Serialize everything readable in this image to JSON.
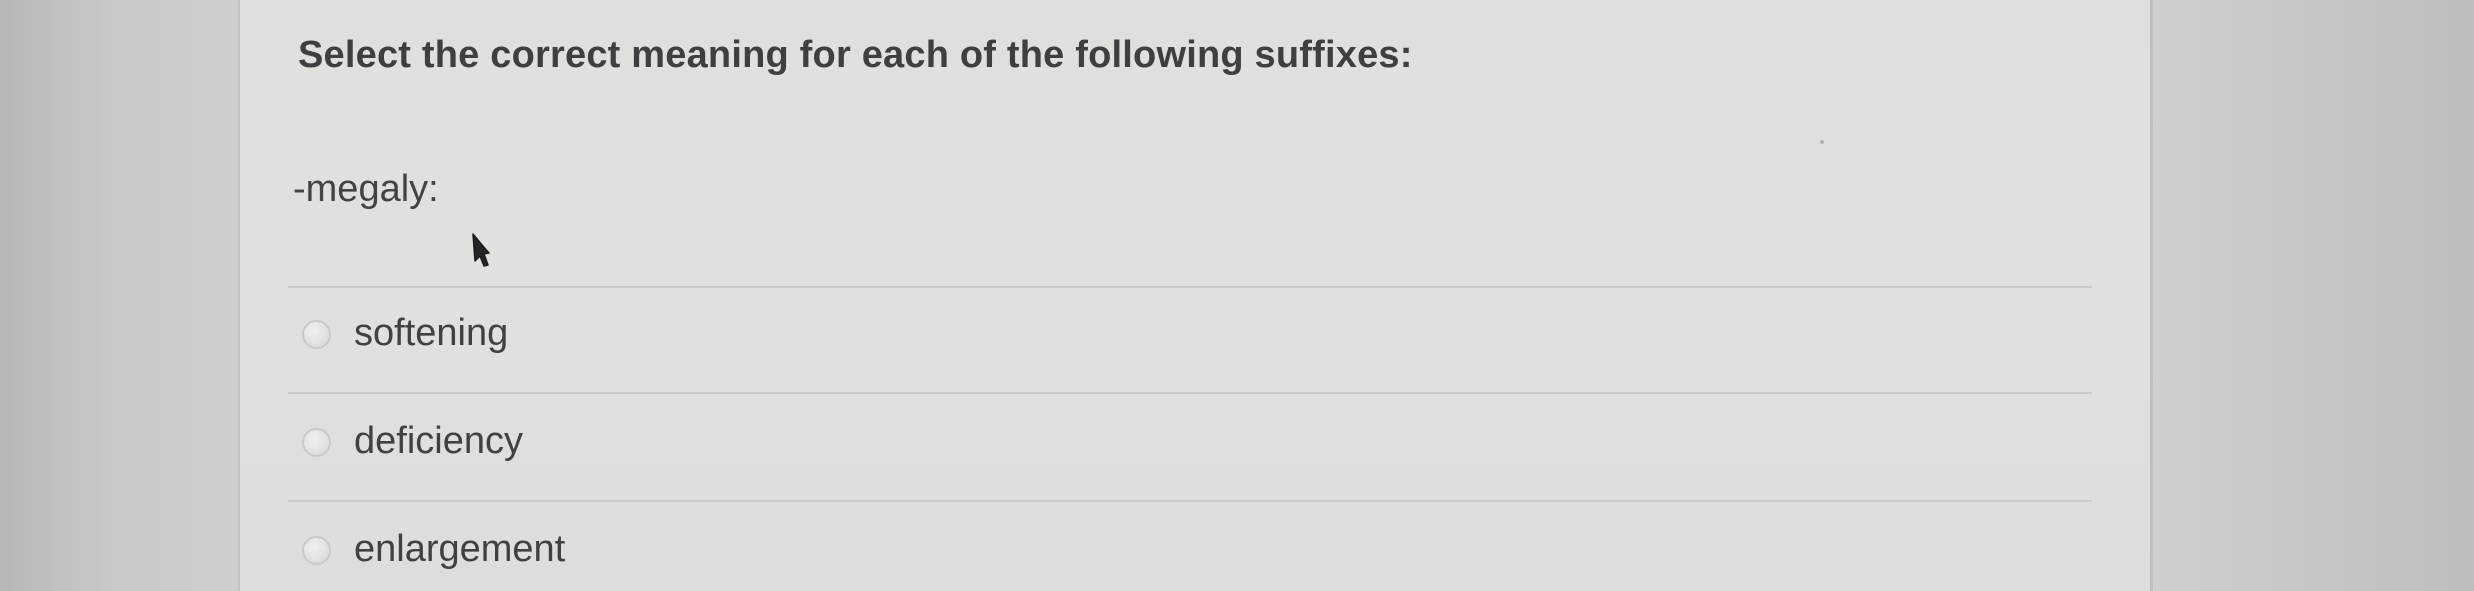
{
  "question": {
    "title": "Select the correct meaning for each of the following suffixes:",
    "term": "-megaly:"
  },
  "options": [
    {
      "label": "softening",
      "selected": false
    },
    {
      "label": "deficiency",
      "selected": false
    },
    {
      "label": "enlargement",
      "selected": false
    }
  ],
  "icons": {
    "cursor": "mouse-pointer-icon",
    "radio": "radio-button-icon"
  },
  "colors": {
    "panel": "#e0e0dd",
    "text": "#414141",
    "divider": "#cbcbc8"
  }
}
